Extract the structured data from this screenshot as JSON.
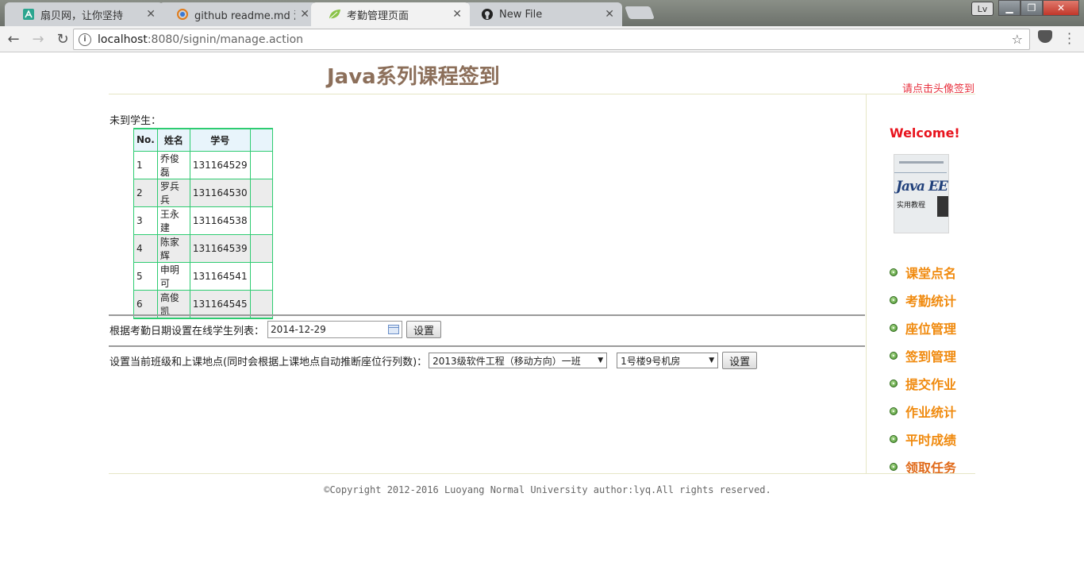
{
  "browser": {
    "tabs": [
      {
        "title": "扇贝网，让你坚持",
        "icon": "shanbay-icon"
      },
      {
        "title": "github readme.md 添加",
        "icon": "search-engine-icon"
      },
      {
        "title": "考勤管理页面",
        "icon": "leaf-icon"
      },
      {
        "title": "New File",
        "icon": "github-icon"
      }
    ],
    "profile": "Lv",
    "url_host": "localhost",
    "url_rest": ":8080/signin/manage.action"
  },
  "page": {
    "title": "Java系列课程签到",
    "sign_hint": "请点击头像签到"
  },
  "absent": {
    "label": "未到学生：",
    "headers": [
      "No.",
      "姓名",
      "学号",
      ""
    ],
    "rows": [
      [
        "1",
        "乔俊磊",
        "131164529",
        ""
      ],
      [
        "2",
        "罗兵兵",
        "131164530",
        ""
      ],
      [
        "3",
        "王永建",
        "131164538",
        ""
      ],
      [
        "4",
        "陈家辉",
        "131164539",
        ""
      ],
      [
        "5",
        "申明可",
        "131164541",
        ""
      ],
      [
        "6",
        "高俊凯",
        "131164545",
        ""
      ]
    ]
  },
  "date_form": {
    "label": "根据考勤日期设置在线学生列表：",
    "date": "2014-12-29",
    "button": "设置"
  },
  "class_form": {
    "label": "设置当前班级和上课地点(同时会根据上课地点自动推断座位行列数)：",
    "class_selected": "2013级软件工程（移动方向）一班",
    "room_selected": "1号楼9号机房",
    "button": "设置"
  },
  "sidebar": {
    "welcome": "Welcome!",
    "avatar": {
      "title": "Java EE",
      "subtitle": "实用教程"
    },
    "menu": [
      "课堂点名",
      "考勤统计",
      "座位管理",
      "签到管理",
      "提交作业",
      "作业统计",
      "平时成绩",
      "领取任务"
    ]
  },
  "footer": "©Copyright 2012-2016 Luoyang Normal University author:lyq.All rights reserved."
}
